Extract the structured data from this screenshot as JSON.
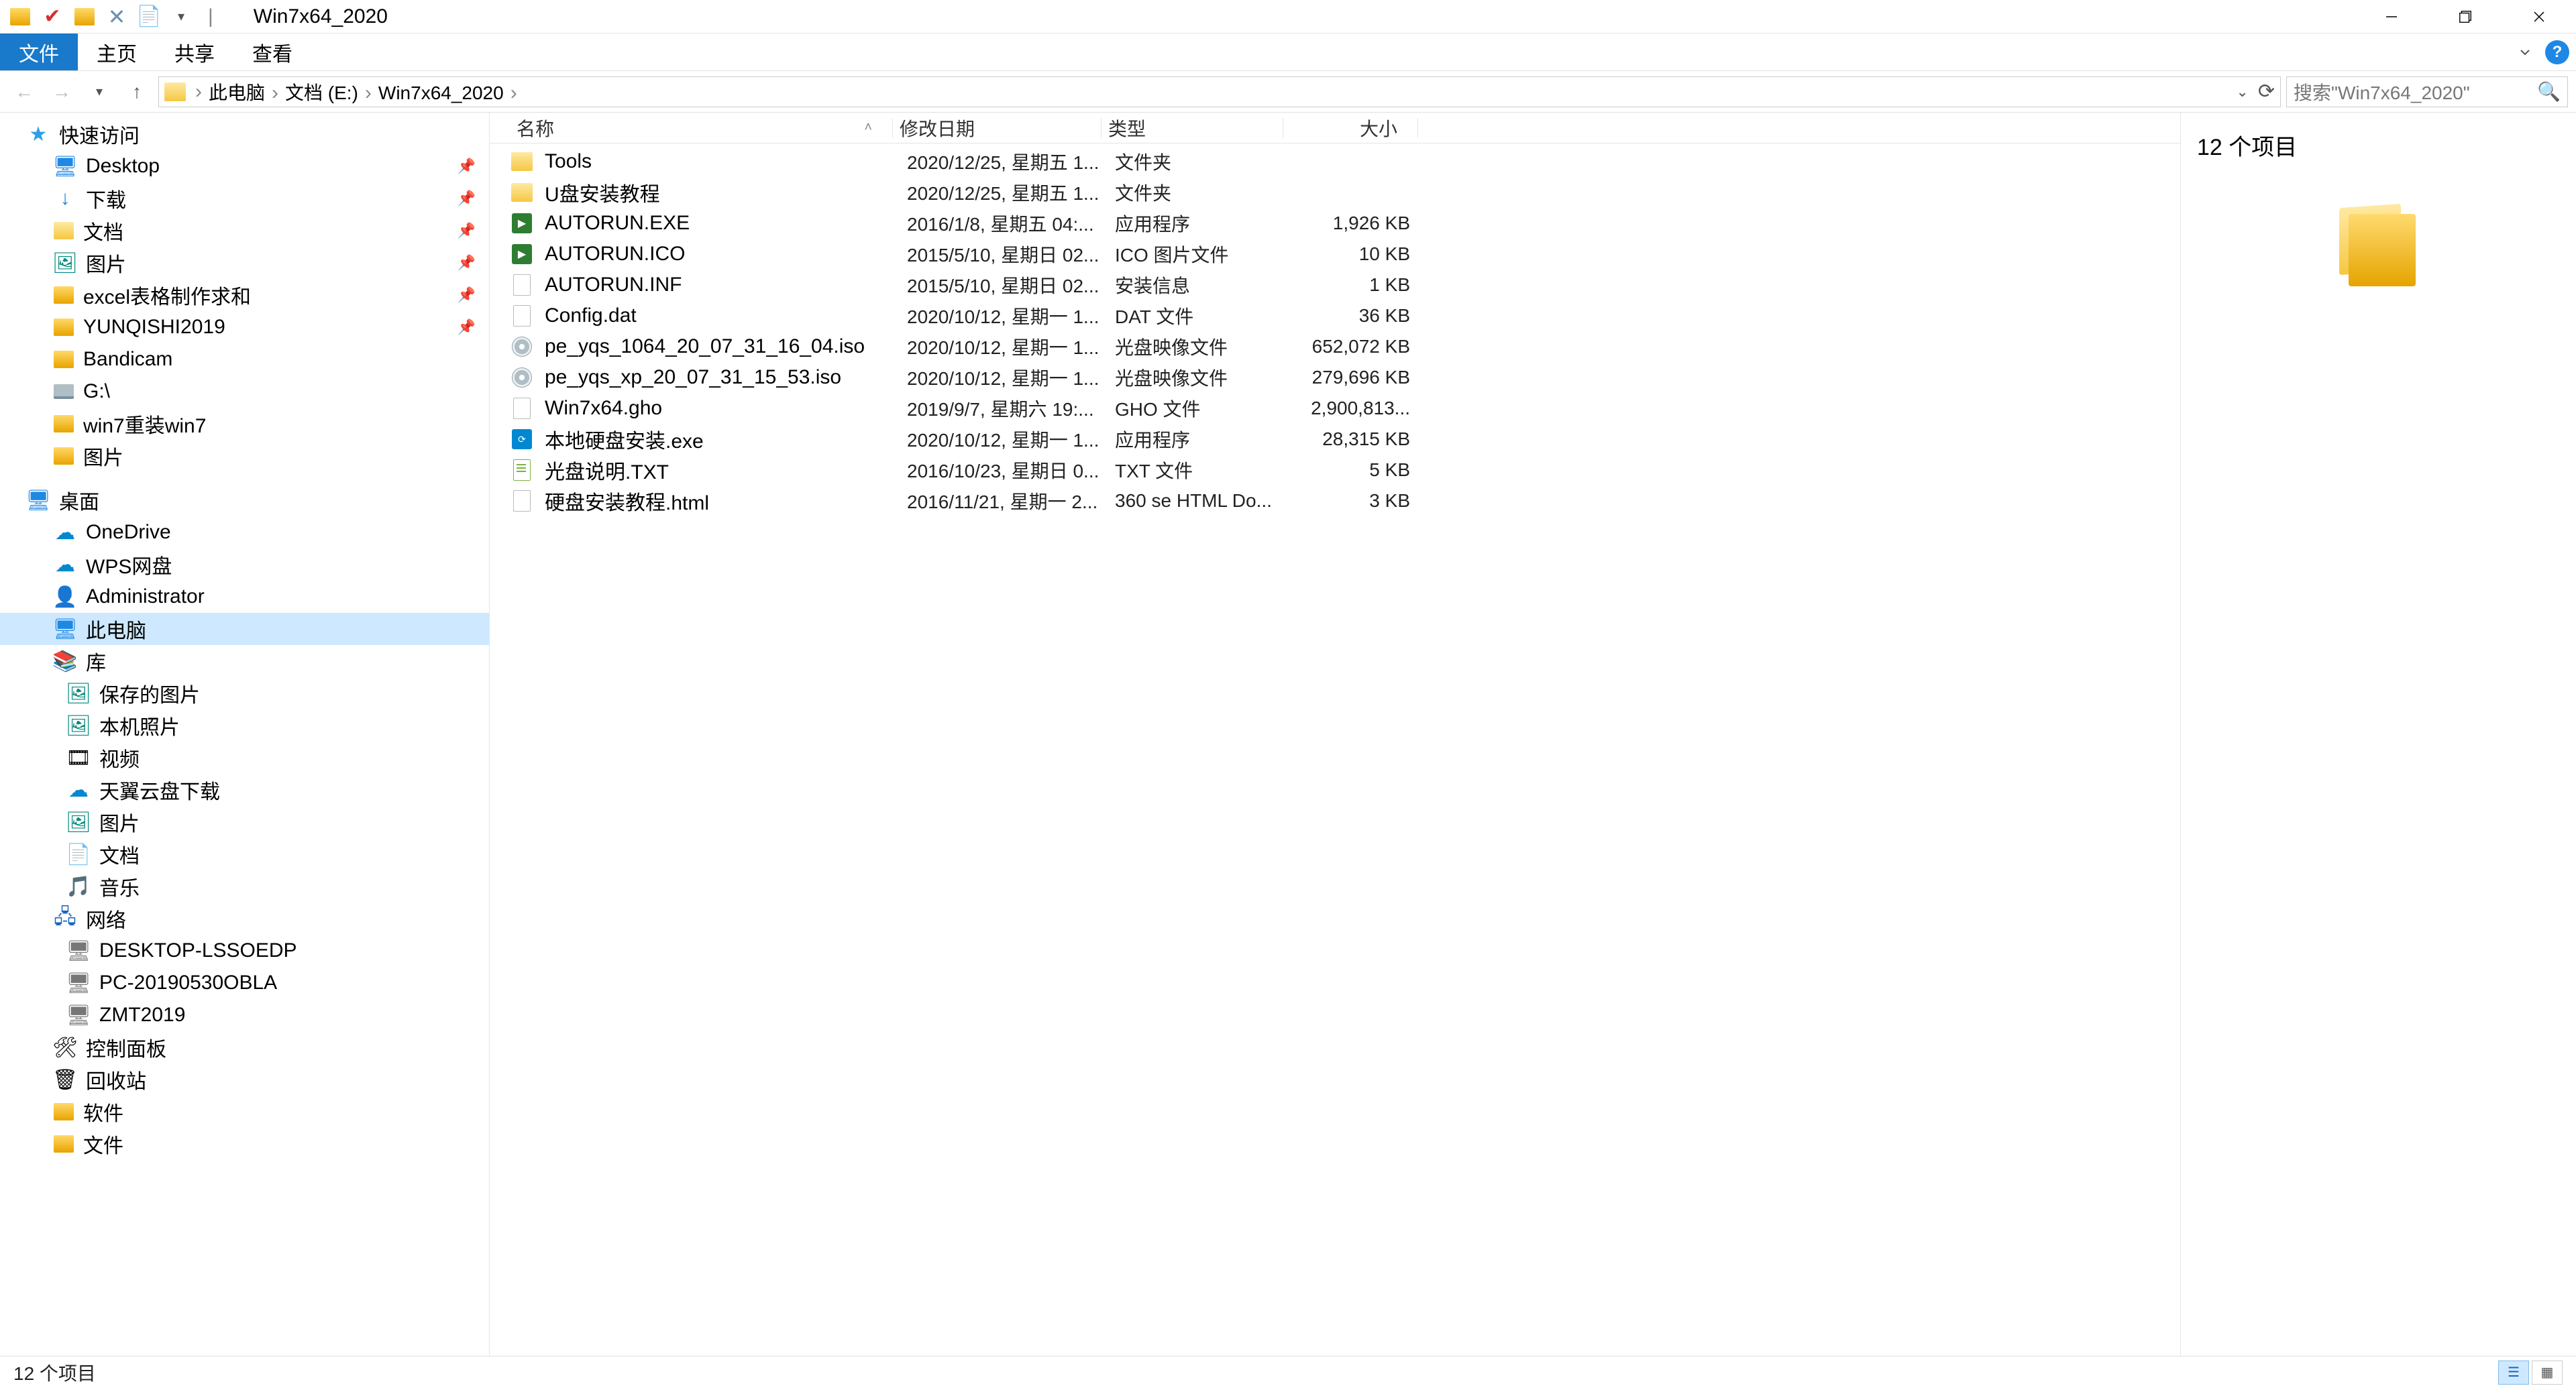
{
  "window": {
    "title": "Win7x64_2020"
  },
  "ribbon": {
    "file": "文件",
    "tabs": [
      "主页",
      "共享",
      "查看"
    ]
  },
  "breadcrumb": {
    "items": [
      "此电脑",
      "文档 (E:)",
      "Win7x64_2020"
    ]
  },
  "search": {
    "placeholder": "搜索\"Win7x64_2020\""
  },
  "columns": {
    "name": "名称",
    "date": "修改日期",
    "type": "类型",
    "size": "大小"
  },
  "sidebar": [
    {
      "label": "快速访问",
      "indent": 0,
      "iconClass": "ico-star",
      "glyph": "★"
    },
    {
      "label": "Desktop",
      "indent": 1,
      "iconClass": "ico-blue",
      "glyph": "🖥",
      "pinned": true
    },
    {
      "label": "下载",
      "indent": 1,
      "iconClass": "ico-blue",
      "glyph": "↓",
      "pinned": true
    },
    {
      "label": "文档",
      "indent": 1,
      "iconClass": "ico-folder",
      "glyph": "",
      "pinned": true
    },
    {
      "label": "图片",
      "indent": 1,
      "iconClass": "ico-teal",
      "glyph": "🖼",
      "pinned": true
    },
    {
      "label": "excel表格制作求和",
      "indent": 1,
      "iconClass": "ico-folder-yellow",
      "glyph": "",
      "pinned": true
    },
    {
      "label": "YUNQISHI2019",
      "indent": 1,
      "iconClass": "ico-folder-yellow",
      "glyph": "",
      "pinned": true
    },
    {
      "label": "Bandicam",
      "indent": 1,
      "iconClass": "ico-folder-yellow",
      "glyph": ""
    },
    {
      "label": "G:\\",
      "indent": 1,
      "iconClass": "ico-drive",
      "glyph": ""
    },
    {
      "label": "win7重装win7",
      "indent": 1,
      "iconClass": "ico-folder-yellow",
      "glyph": ""
    },
    {
      "label": "图片",
      "indent": 1,
      "iconClass": "ico-folder-yellow",
      "glyph": ""
    },
    {
      "label": "桌面",
      "indent": 0,
      "iconClass": "ico-blue",
      "glyph": "🖥",
      "spacer": true
    },
    {
      "label": "OneDrive",
      "indent": 1,
      "iconClass": "ico-cloud",
      "glyph": "☁"
    },
    {
      "label": "WPS网盘",
      "indent": 1,
      "iconClass": "ico-cloud",
      "glyph": "☁"
    },
    {
      "label": "Administrator",
      "indent": 1,
      "iconClass": "",
      "glyph": "👤"
    },
    {
      "label": "此电脑",
      "indent": 1,
      "iconClass": "ico-blue",
      "glyph": "🖥",
      "selected": true
    },
    {
      "label": "库",
      "indent": 1,
      "iconClass": "",
      "glyph": "📚"
    },
    {
      "label": "保存的图片",
      "indent": 2,
      "iconClass": "ico-teal",
      "glyph": "🖼"
    },
    {
      "label": "本机照片",
      "indent": 2,
      "iconClass": "ico-teal",
      "glyph": "🖼"
    },
    {
      "label": "视频",
      "indent": 2,
      "iconClass": "",
      "glyph": "🎞"
    },
    {
      "label": "天翼云盘下载",
      "indent": 2,
      "iconClass": "ico-cloud",
      "glyph": "☁"
    },
    {
      "label": "图片",
      "indent": 2,
      "iconClass": "ico-teal",
      "glyph": "🖼"
    },
    {
      "label": "文档",
      "indent": 2,
      "iconClass": "",
      "glyph": "📄"
    },
    {
      "label": "音乐",
      "indent": 2,
      "iconClass": "",
      "glyph": "🎵"
    },
    {
      "label": "网络",
      "indent": 1,
      "iconClass": "ico-network",
      "glyph": "🖧"
    },
    {
      "label": "DESKTOP-LSSOEDP",
      "indent": 2,
      "iconClass": "ico-pc",
      "glyph": "🖥"
    },
    {
      "label": "PC-20190530OBLA",
      "indent": 2,
      "iconClass": "ico-pc",
      "glyph": "🖥"
    },
    {
      "label": "ZMT2019",
      "indent": 2,
      "iconClass": "ico-pc",
      "glyph": "🖥"
    },
    {
      "label": "控制面板",
      "indent": 1,
      "iconClass": "",
      "glyph": "🛠"
    },
    {
      "label": "回收站",
      "indent": 1,
      "iconClass": "",
      "glyph": "🗑"
    },
    {
      "label": "软件",
      "indent": 1,
      "iconClass": "ico-folder-yellow",
      "glyph": ""
    },
    {
      "label": "文件",
      "indent": 1,
      "iconClass": "ico-folder-yellow",
      "glyph": ""
    }
  ],
  "files": [
    {
      "name": "Tools",
      "date": "2020/12/25, 星期五 1...",
      "type": "文件夹",
      "size": "",
      "icon": "folder"
    },
    {
      "name": "U盘安装教程",
      "date": "2020/12/25, 星期五 1...",
      "type": "文件夹",
      "size": "",
      "icon": "folder"
    },
    {
      "name": "AUTORUN.EXE",
      "date": "2016/1/8, 星期五 04:...",
      "type": "应用程序",
      "size": "1,926 KB",
      "icon": "exe-green"
    },
    {
      "name": "AUTORUN.ICO",
      "date": "2015/5/10, 星期日 02...",
      "type": "ICO 图片文件",
      "size": "10 KB",
      "icon": "exe-green"
    },
    {
      "name": "AUTORUN.INF",
      "date": "2015/5/10, 星期日 02...",
      "type": "安装信息",
      "size": "1 KB",
      "icon": "file"
    },
    {
      "name": "Config.dat",
      "date": "2020/10/12, 星期一 1...",
      "type": "DAT 文件",
      "size": "36 KB",
      "icon": "file"
    },
    {
      "name": "pe_yqs_1064_20_07_31_16_04.iso",
      "date": "2020/10/12, 星期一 1...",
      "type": "光盘映像文件",
      "size": "652,072 KB",
      "icon": "disk"
    },
    {
      "name": "pe_yqs_xp_20_07_31_15_53.iso",
      "date": "2020/10/12, 星期一 1...",
      "type": "光盘映像文件",
      "size": "279,696 KB",
      "icon": "disk"
    },
    {
      "name": "Win7x64.gho",
      "date": "2019/9/7, 星期六 19:...",
      "type": "GHO 文件",
      "size": "2,900,813...",
      "icon": "file"
    },
    {
      "name": "本地硬盘安装.exe",
      "date": "2020/10/12, 星期一 1...",
      "type": "应用程序",
      "size": "28,315 KB",
      "icon": "cfg"
    },
    {
      "name": "光盘说明.TXT",
      "date": "2016/10/23, 星期日 0...",
      "type": "TXT 文件",
      "size": "5 KB",
      "icon": "txt"
    },
    {
      "name": "硬盘安装教程.html",
      "date": "2016/11/21, 星期一 2...",
      "type": "360 se HTML Do...",
      "size": "3 KB",
      "icon": "file"
    }
  ],
  "preview": {
    "title": "12 个项目"
  },
  "statusbar": {
    "text": "12 个项目"
  }
}
